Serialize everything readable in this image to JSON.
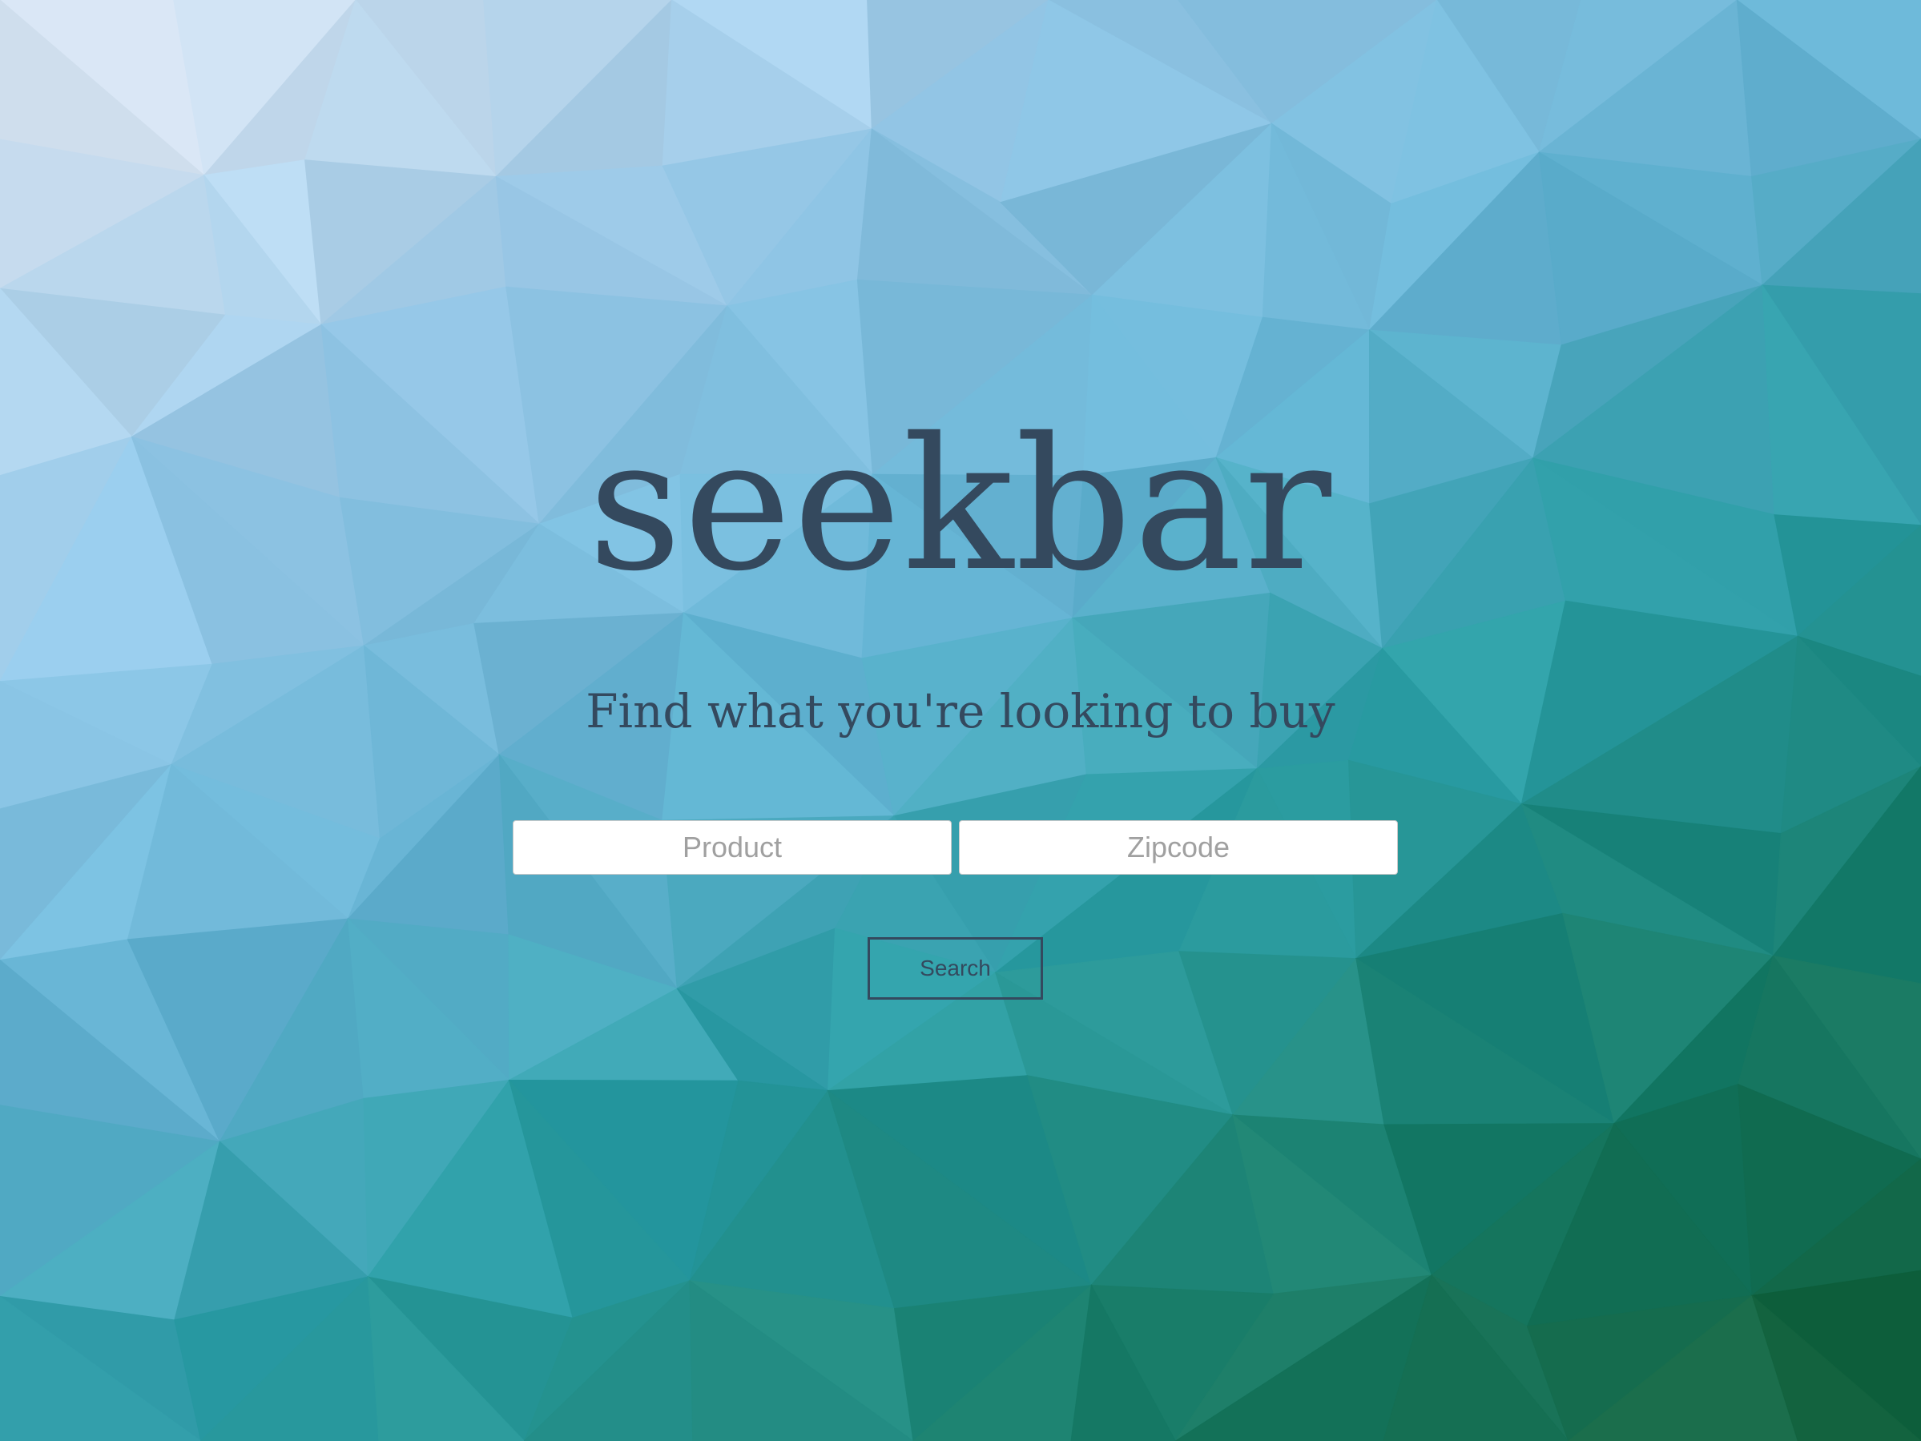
{
  "brand": {
    "logo_text": "seekbar",
    "tagline": "Find what you're looking to buy"
  },
  "search_form": {
    "product_placeholder": "Product",
    "product_value": "",
    "zipcode_placeholder": "Zipcode",
    "zipcode_value": "",
    "submit_label": "Search"
  },
  "colors": {
    "text": "#34495e",
    "background_top_left": "#e8ecf5",
    "background_center": "#4aa8c4",
    "background_bottom_right": "#125c33",
    "input_background": "#ffffff"
  }
}
